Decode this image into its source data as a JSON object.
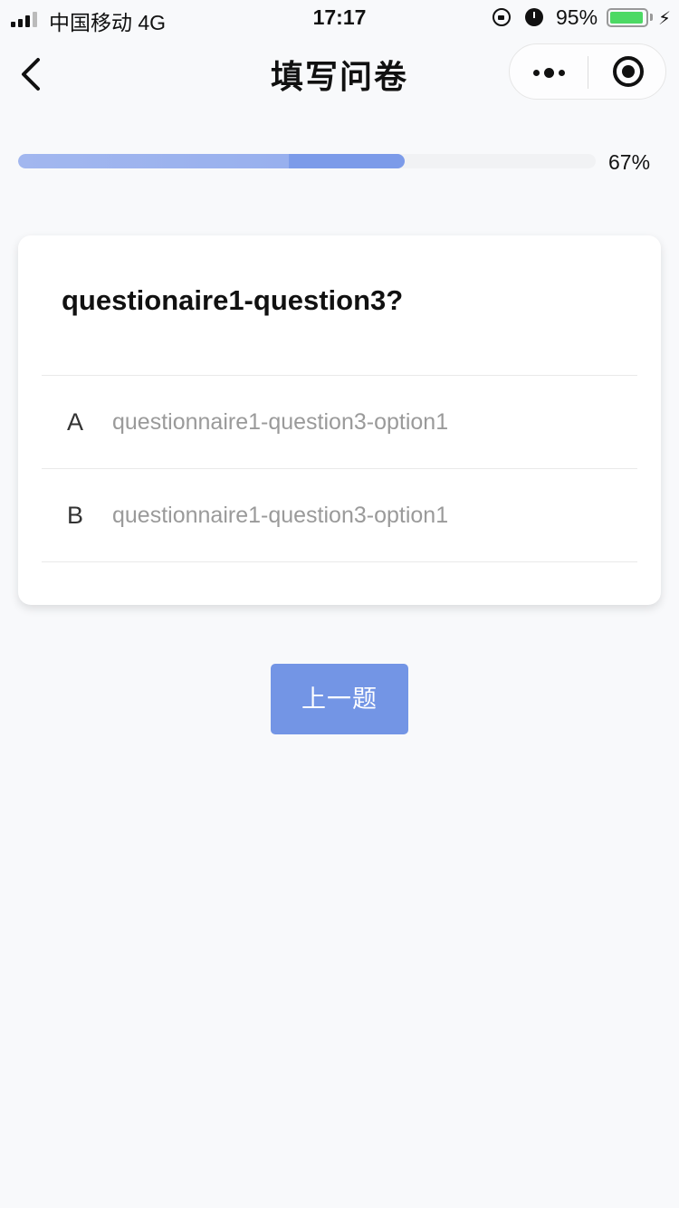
{
  "status_bar": {
    "carrier": "中国移动   4G",
    "time": "17:17",
    "battery_percent": "95%",
    "battery_level": 0.95,
    "icons": [
      "signal-icon",
      "orientation-lock-icon",
      "alarm-icon",
      "battery-icon",
      "charging-icon"
    ]
  },
  "nav": {
    "title": "填写问卷",
    "back_icon": "chevron-left-icon",
    "more_icon": "more-dots-icon",
    "close_icon": "target-circle-icon"
  },
  "progress": {
    "value_percent": 67,
    "label": "67%"
  },
  "question": {
    "title": "questionaire1-question3?",
    "options": [
      {
        "letter": "A",
        "text": "questionnaire1-question3-option1"
      },
      {
        "letter": "B",
        "text": "questionnaire1-question3-option1"
      }
    ]
  },
  "actions": {
    "prev_label": "上一题"
  },
  "colors": {
    "accent": "#7395e5",
    "progress_light": "#a2b7ef",
    "progress_dark": "#7c9be9",
    "background": "#f8f9fb"
  }
}
